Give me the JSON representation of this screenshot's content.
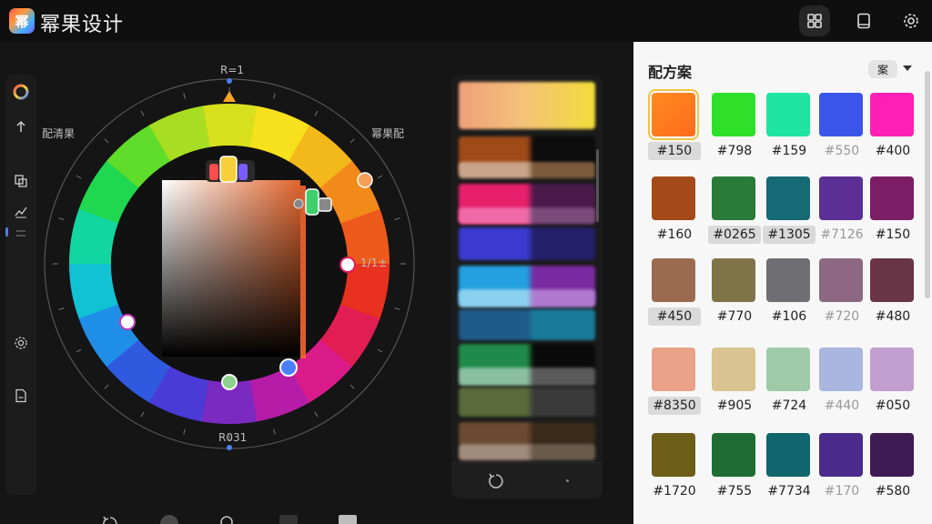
{
  "app": {
    "title": "幂果设计",
    "logo_text": "幂"
  },
  "topbar": {
    "icons": [
      "palette-icon",
      "book-icon",
      "settings-icon"
    ]
  },
  "rail": {
    "icons": [
      "color-wheel-icon",
      "arrow-up-icon",
      "copy-icon",
      "chart-icon",
      "divider-icon",
      "gear-icon",
      "document-icon"
    ],
    "arrow_label": "↑"
  },
  "wheel": {
    "top_label": "R=1",
    "bottom_label": "R031",
    "left_label": "配清果",
    "right_top_label": "幂果配",
    "right_mid_label": "1/1±"
  },
  "palette": {
    "title": "配方案",
    "filter_label": "案",
    "rows": [
      [
        {
          "code": "#150",
          "color": "#ff8a1e",
          "color2": "#ff6b1c",
          "selected": true,
          "tag": true
        },
        {
          "code": "#798",
          "color": "#2fe02a",
          "tag": false
        },
        {
          "code": "#159",
          "color": "#1fe4a2",
          "tag": false
        },
        {
          "code": "#550",
          "color": "#3a56e8",
          "tag": false,
          "faded": true
        },
        {
          "code": "#400",
          "color": "#ff1fb4",
          "tag": false
        }
      ],
      [
        {
          "code": "#160",
          "color": "#a34a18",
          "tag": false
        },
        {
          "code": "#0265",
          "color": "#2a7a3a",
          "tag": true
        },
        {
          "code": "#1305",
          "color": "#156a76",
          "tag": true
        },
        {
          "code": "#7126",
          "color": "#5b2f96",
          "tag": false,
          "faded": true
        },
        {
          "code": "#150",
          "color": "#7b1e66",
          "tag": false
        }
      ],
      [
        {
          "code": "#450",
          "color": "#9b6a4f",
          "tag": true
        },
        {
          "code": "#770",
          "color": "#7f7447",
          "tag": false
        },
        {
          "code": "#106",
          "color": "#6f6f73",
          "tag": false
        },
        {
          "code": "#720",
          "color": "#8c6882",
          "tag": false,
          "faded": true
        },
        {
          "code": "#480",
          "color": "#6a3547",
          "tag": false
        }
      ],
      [
        {
          "code": "#8350",
          "color": "#e9a287",
          "tag": true
        },
        {
          "code": "#905",
          "color": "#d8c391",
          "tag": false
        },
        {
          "code": "#724",
          "color": "#9fcaa8",
          "tag": false
        },
        {
          "code": "#440",
          "color": "#a8b6e0",
          "tag": false,
          "faded": true
        },
        {
          "code": "#050",
          "color": "#c39ed0",
          "tag": false
        }
      ],
      [
        {
          "code": "#1720",
          "color": "#6e5e1a",
          "tag": false
        },
        {
          "code": "#755",
          "color": "#1f6d35",
          "tag": false
        },
        {
          "code": "#7734",
          "color": "#11656c",
          "tag": false
        },
        {
          "code": "#170",
          "color": "#4a2a8a",
          "tag": false,
          "faded": true
        },
        {
          "code": "#580",
          "color": "#3e1b52",
          "tag": false
        }
      ]
    ]
  }
}
